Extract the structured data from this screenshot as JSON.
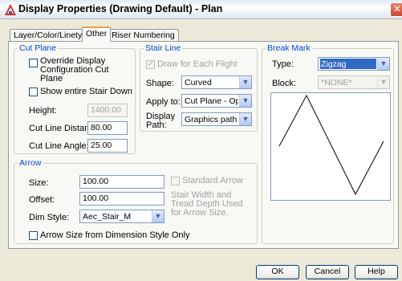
{
  "window": {
    "title": "Display Properties (Drawing Default) - Plan",
    "close_glyph": "✕"
  },
  "tabs": [
    {
      "label": "Layer/Color/Linetype"
    },
    {
      "label": "Other"
    },
    {
      "label": "Riser Numbering"
    }
  ],
  "cut_plane": {
    "legend": "Cut Plane",
    "override_label": "Override Display Configuration Cut Plane",
    "override_checked": false,
    "show_entire_label": "Show entire Stair Down",
    "show_entire_checked": false,
    "height_label": "Height:",
    "height_value": "1400.00",
    "cut_line_distance_label": "Cut Line Distance:",
    "cut_line_distance_value": "80.00",
    "cut_line_angle_label": "Cut Line Angle:",
    "cut_line_angle_value": "25.00"
  },
  "stair_line": {
    "legend": "Stair Line",
    "draw_each_flight_label": "Draw for Each Flight",
    "draw_each_flight_checked": true,
    "shape_label": "Shape:",
    "shape_value": "Curved",
    "apply_to_label": "Apply to:",
    "apply_to_value": "Cut Plane - Opposite",
    "display_path_label": "Display Path:",
    "display_path_value": "Graphics path"
  },
  "break_mark": {
    "legend": "Break Mark",
    "type_label": "Type:",
    "type_value": "Zigzag",
    "block_label": "Block:",
    "block_value": "*NONE*"
  },
  "arrow": {
    "legend": "Arrow",
    "size_label": "Size:",
    "size_value": "100.00",
    "offset_label": "Offset:",
    "offset_value": "100.00",
    "dim_style_label": "Dim Style:",
    "dim_style_value": "Aec_Stair_M",
    "standard_arrow_label": "Standard Arrow",
    "standard_arrow_checked": false,
    "note": "Stair Width and Tread Depth Used for Arrow Size.",
    "size_from_dim_label": "Arrow Size from Dimension Style Only",
    "size_from_dim_checked": false
  },
  "buttons": {
    "ok": "OK",
    "cancel": "Cancel",
    "help": "Help"
  }
}
